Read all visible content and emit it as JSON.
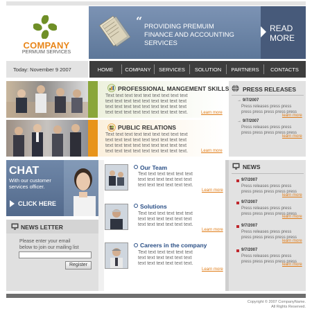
{
  "logo": {
    "name": "COMPANY",
    "tagline": "PERMUIM SERVICES"
  },
  "banner": {
    "quote_mark": "“",
    "lines": [
      "PROVIDING PREMUIM",
      "FINANCE AND ACCOUNTING",
      "SERVICES"
    ],
    "read_more": [
      "READ",
      "MORE"
    ]
  },
  "date": "Today: November 9 2007",
  "nav": [
    "HOME",
    "COMPANY",
    "SERVICES",
    "SOLUTION",
    "PARTNERS",
    "CONTACTS"
  ],
  "features": [
    {
      "title": "PROFESSIONAL MANGEMENT SKILLS",
      "lines": [
        "Text text text text text text text text text",
        "text text text text text text text text text",
        "text text text text text text text text text",
        "text text text text text text text text text."
      ],
      "learn": "Learn more",
      "accent": "#8aa63a"
    },
    {
      "title": "PUBLIC RELATIONS",
      "lines": [
        "Text text text text text text text text text",
        "text text text text text text text text text",
        "text text text text text text text text text",
        "text text text text text text text text text."
      ],
      "learn": "Learn more",
      "accent": "#e8941a"
    }
  ],
  "press": {
    "heading": "PRESS RELEASES",
    "items": [
      {
        "date": "9/7/2007",
        "lines": [
          "Press releases press press",
          "press press press press press"
        ],
        "learn": "learn more"
      },
      {
        "date": "9/7/2007",
        "lines": [
          "Press releases press press",
          "press press press press press"
        ],
        "learn": "learn more"
      }
    ]
  },
  "chat": {
    "title": "CHAT",
    "lines": [
      "With our customer",
      "services officer."
    ],
    "button": "CLICK HERE"
  },
  "newsletter": {
    "heading": "NEWS LETTER",
    "lines": [
      "Please enter your email",
      "below to join our mailing list"
    ],
    "input_value": "",
    "button": "Register"
  },
  "middle": [
    {
      "title": "Our Team",
      "lines": [
        "Text text text text text text",
        "text text text text text text",
        "text text text text text text."
      ],
      "learn": "Learn more"
    },
    {
      "title": "Solutions",
      "lines": [
        "Text text text text text text",
        "text text text text text text",
        "text text text text text text."
      ],
      "learn": "Learn more"
    },
    {
      "title": "Careers in the company",
      "lines": [
        "Text text text text text text",
        "text text text text text text",
        "text text text text text text."
      ],
      "learn": "Learn more"
    }
  ],
  "news": {
    "heading": "NEWS",
    "items": [
      {
        "date": "9/7/2007",
        "lines": [
          "Press releases press press",
          "press press press press press"
        ],
        "learn": "learn more"
      },
      {
        "date": "9/7/2007",
        "lines": [
          "Press releases press press",
          "press press press press press"
        ],
        "learn": "learn more"
      },
      {
        "date": "9/7/2007",
        "lines": [
          "Press releases press press",
          "press press press press press"
        ],
        "learn": "learn more"
      },
      {
        "date": "9/7/2007",
        "lines": [
          "Press releases press press",
          "press press press press press"
        ],
        "learn": "learn more"
      }
    ]
  },
  "footer": {
    "lines": [
      "Copyright © 2007 CompanyName.",
      "All Rights Reserved."
    ]
  },
  "colors": {
    "accent_orange": "#e8861a",
    "banner_blue": "#5d7799",
    "nav_dark": "#3d3d3d",
    "link_blue": "#2a4f86",
    "news_red": "#c0272d"
  }
}
